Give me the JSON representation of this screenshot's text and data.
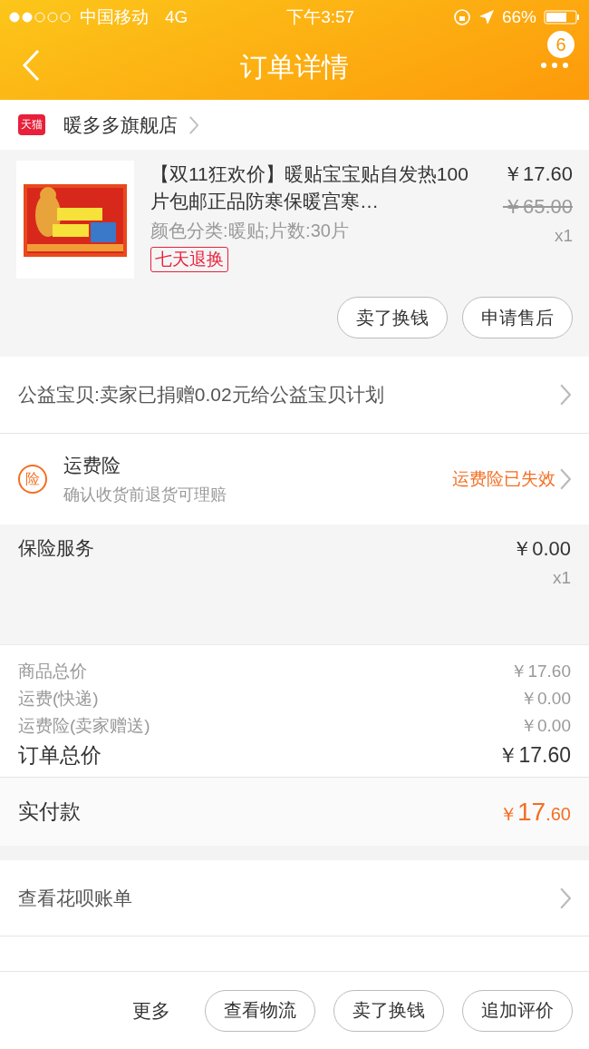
{
  "status_bar": {
    "signal_carrier": "中国移动",
    "network": "4G",
    "time": "下午3:57",
    "battery": "66%"
  },
  "nav": {
    "title": "订单详情",
    "badge": "6"
  },
  "shop": {
    "badge": "天猫",
    "name": "暖多多旗舰店"
  },
  "product": {
    "title": "【双11狂欢价】暖贴宝宝贴自发热100片包邮正品防寒保暖宫寒…",
    "spec": "颜色分类:暖贴;片数:30片",
    "tag": "七天退换",
    "price": "￥17.60",
    "original_price": "￥65.00",
    "quantity": "x1",
    "actions": [
      "卖了换钱",
      "申请售后"
    ]
  },
  "charity": {
    "text": "公益宝贝:卖家已捐赠0.02元给公益宝贝计划"
  },
  "shipping_insurance": {
    "icon_text": "险",
    "title": "运费险",
    "subtitle": "确认收货前退货可理赔",
    "status": "运费险已失效"
  },
  "insurance_service": {
    "title": "保险服务",
    "price": "￥0.00",
    "quantity": "x1"
  },
  "summary": [
    {
      "label": "商品总价",
      "value": "￥17.60",
      "kind": "minor"
    },
    {
      "label": "运费(快递)",
      "value": "￥0.00",
      "kind": "minor"
    },
    {
      "label": "运费险(卖家赠送)",
      "value": "￥0.00",
      "kind": "minor"
    },
    {
      "label": "订单总价",
      "value": "￥17.60",
      "kind": "total"
    }
  ],
  "payment": {
    "label": "实付款",
    "currency": "￥",
    "integer": "17",
    "decimal": ".60"
  },
  "huabei": {
    "text": "查看花呗账单"
  },
  "bottom_bar": {
    "more": "更多",
    "buttons": [
      "查看物流",
      "卖了换钱",
      "追加评价"
    ]
  }
}
